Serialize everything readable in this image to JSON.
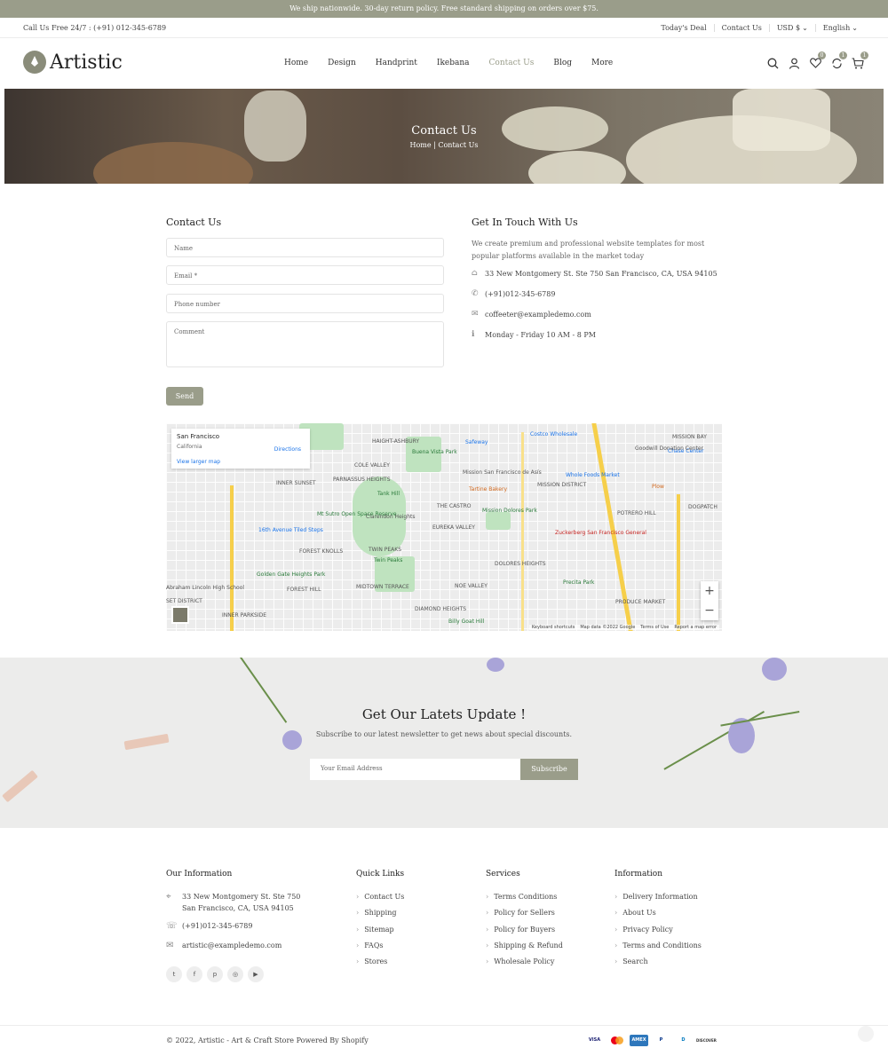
{
  "announcement": "We ship nationwide. 30-day return policy. Free standard shipping on orders over $75.",
  "topbar": {
    "call": "Call Us Free 24/7 : (+91) 012-345-6789",
    "links": [
      "Today's Deal",
      "Contact Us",
      "USD $",
      "English"
    ]
  },
  "header": {
    "logo": "Artistic",
    "nav": [
      "Home",
      "Design",
      "Handprint",
      "Ikebana",
      "Contact Us",
      "Blog",
      "More"
    ],
    "active_nav": "Contact Us",
    "wishlist_count": "0",
    "compare_count": "1",
    "cart_count": "1"
  },
  "hero": {
    "title": "Contact Us",
    "breadcrumb": "Home | Contact Us"
  },
  "contact_form": {
    "title": "Contact Us",
    "name_placeholder": "Name",
    "email_placeholder": "Email *",
    "phone_placeholder": "Phone number",
    "comment_placeholder": "Comment",
    "send_label": "Send"
  },
  "touch": {
    "title": "Get In Touch With Us",
    "description": "We create premium and professional website templates for most popular platforms available in the market today",
    "address": "33 New Montgomery St. Ste 750 San Francisco, CA, USA 94105",
    "phone": "(+91)012-345-6789",
    "email": "coffeeter@exampledemo.com",
    "hours": "Monday - Friday 10 AM - 8 PM"
  },
  "map": {
    "place": "San Francisco",
    "region": "California",
    "larger_map": "View larger map",
    "directions": "Directions",
    "labels": [
      "HAIGHT-ASHBURY",
      "COLE VALLEY",
      "INNER SUNSET",
      "PARNASSUS HEIGHTS",
      "THE CASTRO",
      "MISSION DISTRICT",
      "EUREKA VALLEY",
      "POTRERO HILL",
      "FOREST KNOLLS",
      "TWIN PEAKS",
      "DOLORES HEIGHTS",
      "NOE VALLEY",
      "FOREST HILL",
      "MIDTOWN TERRACE",
      "INNER PARKSIDE",
      "DIAMOND HEIGHTS",
      "PRODUCE MARKET",
      "DOGPATCH",
      "Twin Peaks",
      "Tank Hill",
      "Mission Dolores Park",
      "Tartine Bakery",
      "Whole Foods Market",
      "Safeway",
      "Costco Wholesale",
      "Zuckerberg San Francisco General",
      "Precita Park",
      "Glen Canyon",
      "16th Avenue Tiled Steps",
      "Golden Gate Heights Park",
      "Mt Sutro Open Space Reserve",
      "Clarendon Heights",
      "Plow",
      "Chase Center",
      "Buena Vista Park",
      "Mission San Francisco de Asís",
      "Goodwill Donation Center",
      "Billy Goat Hill",
      "Abraham Lincoln High School",
      "SET DISTRICT",
      "PARKSIDE",
      "MISSION BAY"
    ],
    "footer": [
      "Keyboard shortcuts",
      "Map data ©2022 Google",
      "Terms of Use",
      "Report a map error"
    ],
    "zoom_in": "+",
    "zoom_out": "−"
  },
  "newsletter": {
    "title": "Get Our Latets Update !",
    "subtitle": "Subscribe to our latest newsletter to get news about special discounts.",
    "placeholder": "Your Email Address",
    "button": "Subscribe"
  },
  "footer": {
    "info_title": "Our Information",
    "info_address": "33 New Montgomery St. Ste 750 San Francisco, CA, USA 94105",
    "info_phone": "(+91)012-345-6789",
    "info_email": "artistic@exampledemo.com",
    "quick_title": "Quick Links",
    "quick_links": [
      "Contact Us",
      "Shipping",
      "Sitemap",
      "FAQs",
      "Stores"
    ],
    "services_title": "Services",
    "services": [
      "Terms Conditions",
      "Policy for Sellers",
      "Policy for Buyers",
      "Shipping & Refund",
      "Wholesale Policy"
    ],
    "information_title": "Information",
    "information": [
      "Delivery Information",
      "About Us",
      "Privacy Policy",
      "Terms and Conditions",
      "Search"
    ],
    "social": [
      "twitter-icon",
      "facebook-icon",
      "pinterest-icon",
      "instagram-icon",
      "youtube-icon"
    ],
    "copyright": "© 2022, Artistic - Art & Craft Store Powered By Shopify",
    "payments": [
      "VISA",
      "mastercard",
      "AMEX",
      "PayPal",
      "Diners",
      "DISCOVER"
    ]
  },
  "colors": {
    "accent": "#9a9d8a",
    "announcement_bg": "#9a9d8a"
  }
}
